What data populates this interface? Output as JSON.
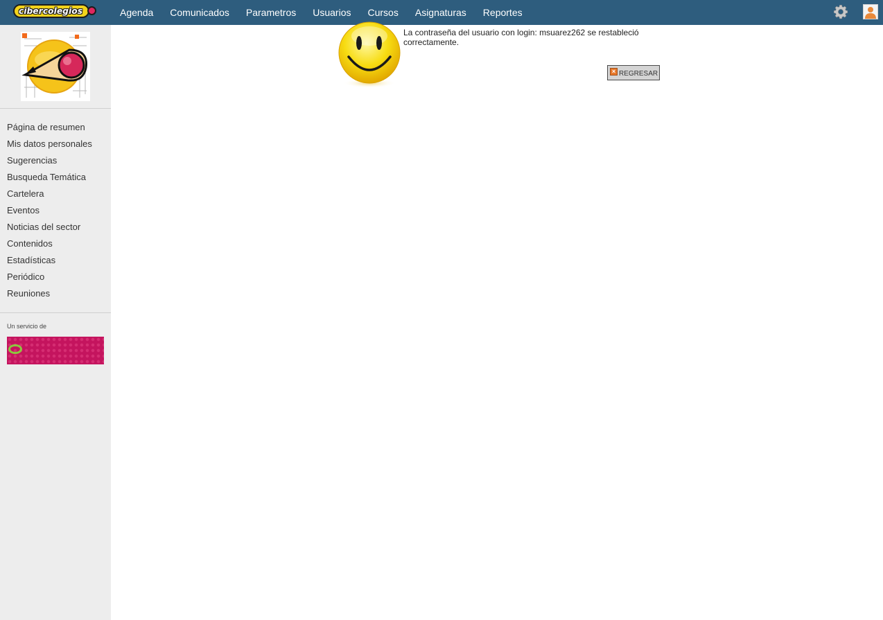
{
  "header": {
    "logo_text": "cibercolegios",
    "nav": [
      "Agenda",
      "Comunicados",
      "Parametros",
      "Usuarios",
      "Cursos",
      "Asignaturas",
      "Reportes"
    ],
    "icons": [
      "gear-icon",
      "user-avatar-icon"
    ]
  },
  "sidebar": {
    "menu": [
      "Página de resumen",
      "Mis datos personales",
      "Sugerencias",
      "Busqueda Temática",
      "Cartelera",
      "Eventos",
      "Noticias del sector",
      "Contenidos",
      "Estadísticas",
      "Periódico",
      "Reuniones"
    ],
    "service_label": "Un servicio de"
  },
  "main": {
    "message": "La contraseña del usuario con login: msuarez262 se restableció correctamente.",
    "back_button": "REGRESAR"
  },
  "colors": {
    "topbar": "#2e5d7e",
    "sidebar": "#ededed",
    "sponsor": "#c4145e"
  }
}
